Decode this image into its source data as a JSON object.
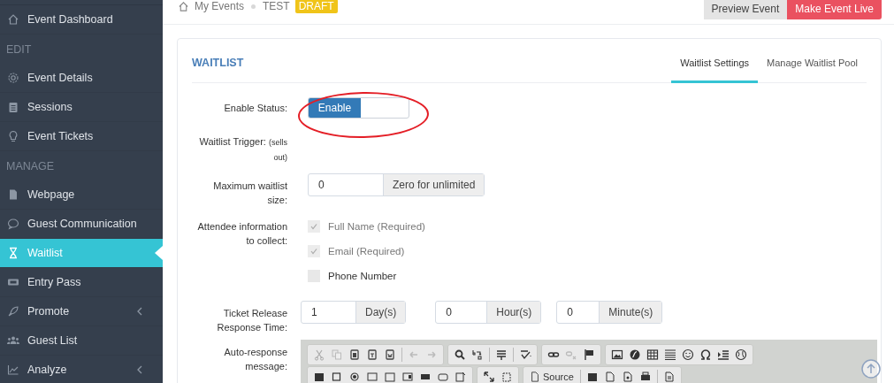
{
  "sidebar": {
    "items": [
      {
        "kind": "item",
        "label": "Event Dashboard",
        "selected": false,
        "collapsible": false
      },
      {
        "kind": "section",
        "label": "EDIT"
      },
      {
        "kind": "item",
        "label": "Event Details",
        "selected": false,
        "collapsible": false
      },
      {
        "kind": "item",
        "label": "Sessions",
        "selected": false,
        "collapsible": false
      },
      {
        "kind": "item",
        "label": "Event Tickets",
        "selected": false,
        "collapsible": false
      },
      {
        "kind": "section",
        "label": "MANAGE"
      },
      {
        "kind": "item",
        "label": "Webpage",
        "selected": false,
        "collapsible": false
      },
      {
        "kind": "item",
        "label": "Guest Communication",
        "selected": false,
        "collapsible": false
      },
      {
        "kind": "item",
        "label": "Waitlist",
        "selected": true,
        "collapsible": false
      },
      {
        "kind": "item",
        "label": "Entry Pass",
        "selected": false,
        "collapsible": false
      },
      {
        "kind": "item",
        "label": "Promote",
        "selected": false,
        "collapsible": true
      },
      {
        "kind": "item",
        "label": "Guest List",
        "selected": false,
        "collapsible": false
      },
      {
        "kind": "item",
        "label": "Analyze",
        "selected": false,
        "collapsible": true
      }
    ]
  },
  "breadcrumb": {
    "items": [
      "My Events",
      "TEST"
    ],
    "badge": "DRAFT"
  },
  "header_buttons": [
    {
      "label": "Preview Event",
      "kind": "secondary"
    },
    {
      "label": "Make Event Live",
      "kind": "danger"
    }
  ],
  "panel": {
    "title": "WAITLIST",
    "tabs": [
      {
        "label": "Waitlist Settings",
        "selected": true
      },
      {
        "label": "Manage Waitlist Pool",
        "selected": false
      }
    ],
    "enable_status": {
      "label": "Enable Status:",
      "toggle": {
        "label": "Enable",
        "on": true
      }
    },
    "waitlist_trigger": {
      "label": "Waitlist Trigger:",
      "note": "(sells out)"
    },
    "max_size": {
      "label": "Maximum waitlist size:",
      "value": "0",
      "addon": "Zero for unlimited"
    },
    "attendee_info": {
      "label": "Attendee information to collect:",
      "options": [
        {
          "label": "Full Name (Required)",
          "checked": true,
          "disabled": true
        },
        {
          "label": "Email (Required)",
          "checked": true,
          "disabled": true
        },
        {
          "label": "Phone Number",
          "checked": false,
          "disabled": false
        }
      ]
    },
    "response_time": {
      "label": "Ticket Release Response Time:",
      "fields": [
        {
          "value": "1",
          "addon": "Day(s)"
        },
        {
          "value": "0",
          "addon": "Hour(s)"
        },
        {
          "value": "0",
          "addon": "Minute(s)"
        }
      ]
    },
    "auto_response": {
      "label": "Auto-response message:",
      "source_button": "Source"
    }
  }
}
